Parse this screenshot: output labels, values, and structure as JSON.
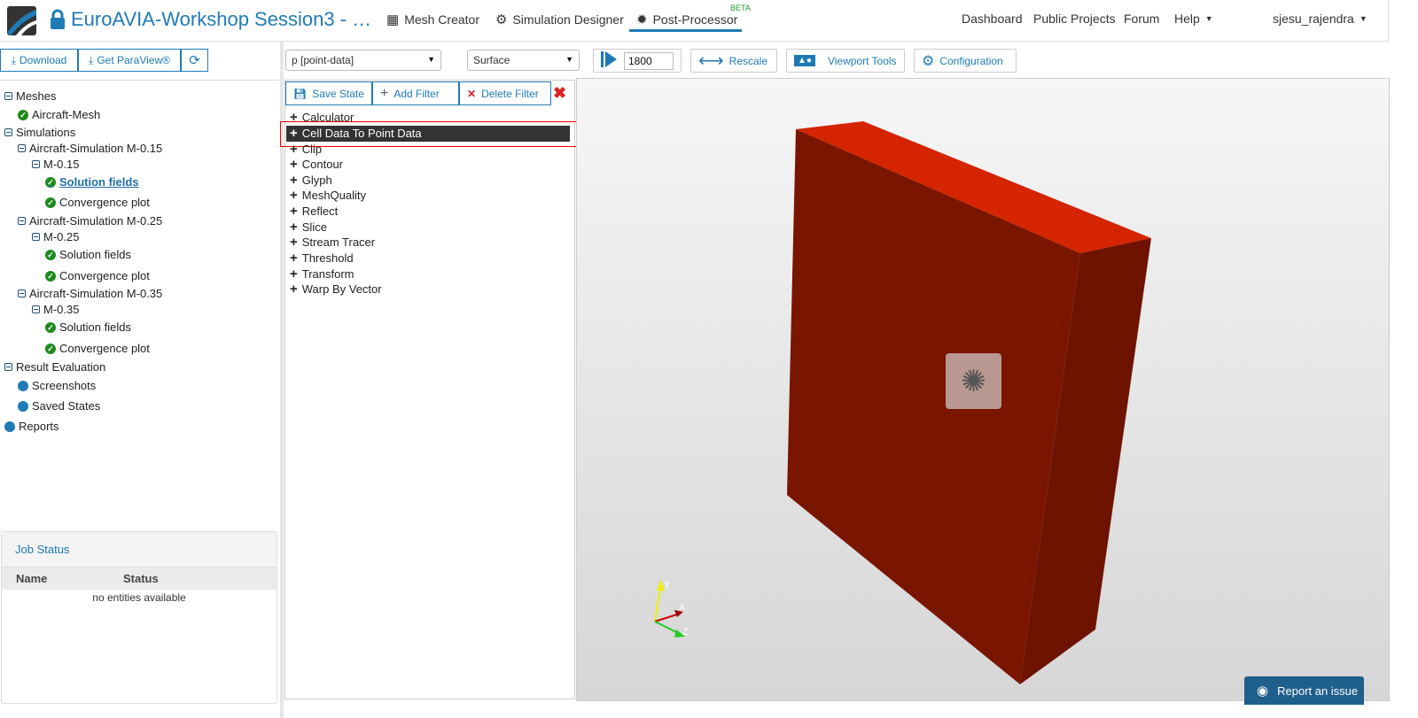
{
  "header": {
    "title": "EuroAVIA-Workshop Session3 - …",
    "nav": [
      "Mesh Creator",
      "Simulation Designer",
      "Post-Processor"
    ],
    "beta": "BETA",
    "right": [
      "Dashboard",
      "Public Projects",
      "Forum",
      "Help"
    ],
    "user": "sjesu_rajendra"
  },
  "left_toolbar": {
    "download": "Download",
    "paraview": "Get ParaView®"
  },
  "tree": {
    "meshes": "Meshes",
    "mesh": "Aircraft-Mesh",
    "simulations": "Simulations",
    "sims": [
      {
        "name": "Aircraft-Simulation M-0.15",
        "run": "M-0.15",
        "solution": "Solution fields",
        "convergence": "Convergence plot"
      },
      {
        "name": "Aircraft-Simulation M-0.25",
        "run": "M-0.25",
        "solution": "Solution fields",
        "convergence": "Convergence plot"
      },
      {
        "name": "Aircraft-Simulation M-0.35",
        "run": "M-0.35",
        "solution": "Solution fields",
        "convergence": "Convergence plot"
      }
    ],
    "result": "Result Evaluation",
    "screenshots": "Screenshots",
    "saved": "Saved States",
    "reports": "Reports"
  },
  "job_status": {
    "title": "Job Status",
    "col_name": "Name",
    "col_status": "Status",
    "empty": "no entities available"
  },
  "toolbar": {
    "field": "p [point-data]",
    "representation": "Surface",
    "time": "1800",
    "rescale": "Rescale",
    "viewport": "Viewport Tools",
    "config": "Configuration"
  },
  "filter_toolbar": {
    "save": "Save State",
    "add": "Add Filter",
    "delete": "Delete Filter"
  },
  "filters": [
    "Calculator",
    "Cell Data To Point Data",
    "Clip",
    "Contour",
    "Glyph",
    "MeshQuality",
    "Reflect",
    "Slice",
    "Stream Tracer",
    "Threshold",
    "Transform",
    "Warp By Vector"
  ],
  "selected_filter": "Cell Data To Point Data",
  "axes": {
    "y": "Y",
    "x": "X",
    "z": "Z"
  },
  "report": "Report an issue",
  "colors": {
    "accent": "#1f7bb5",
    "object": "#7a1500",
    "object_top": "#d42400"
  }
}
